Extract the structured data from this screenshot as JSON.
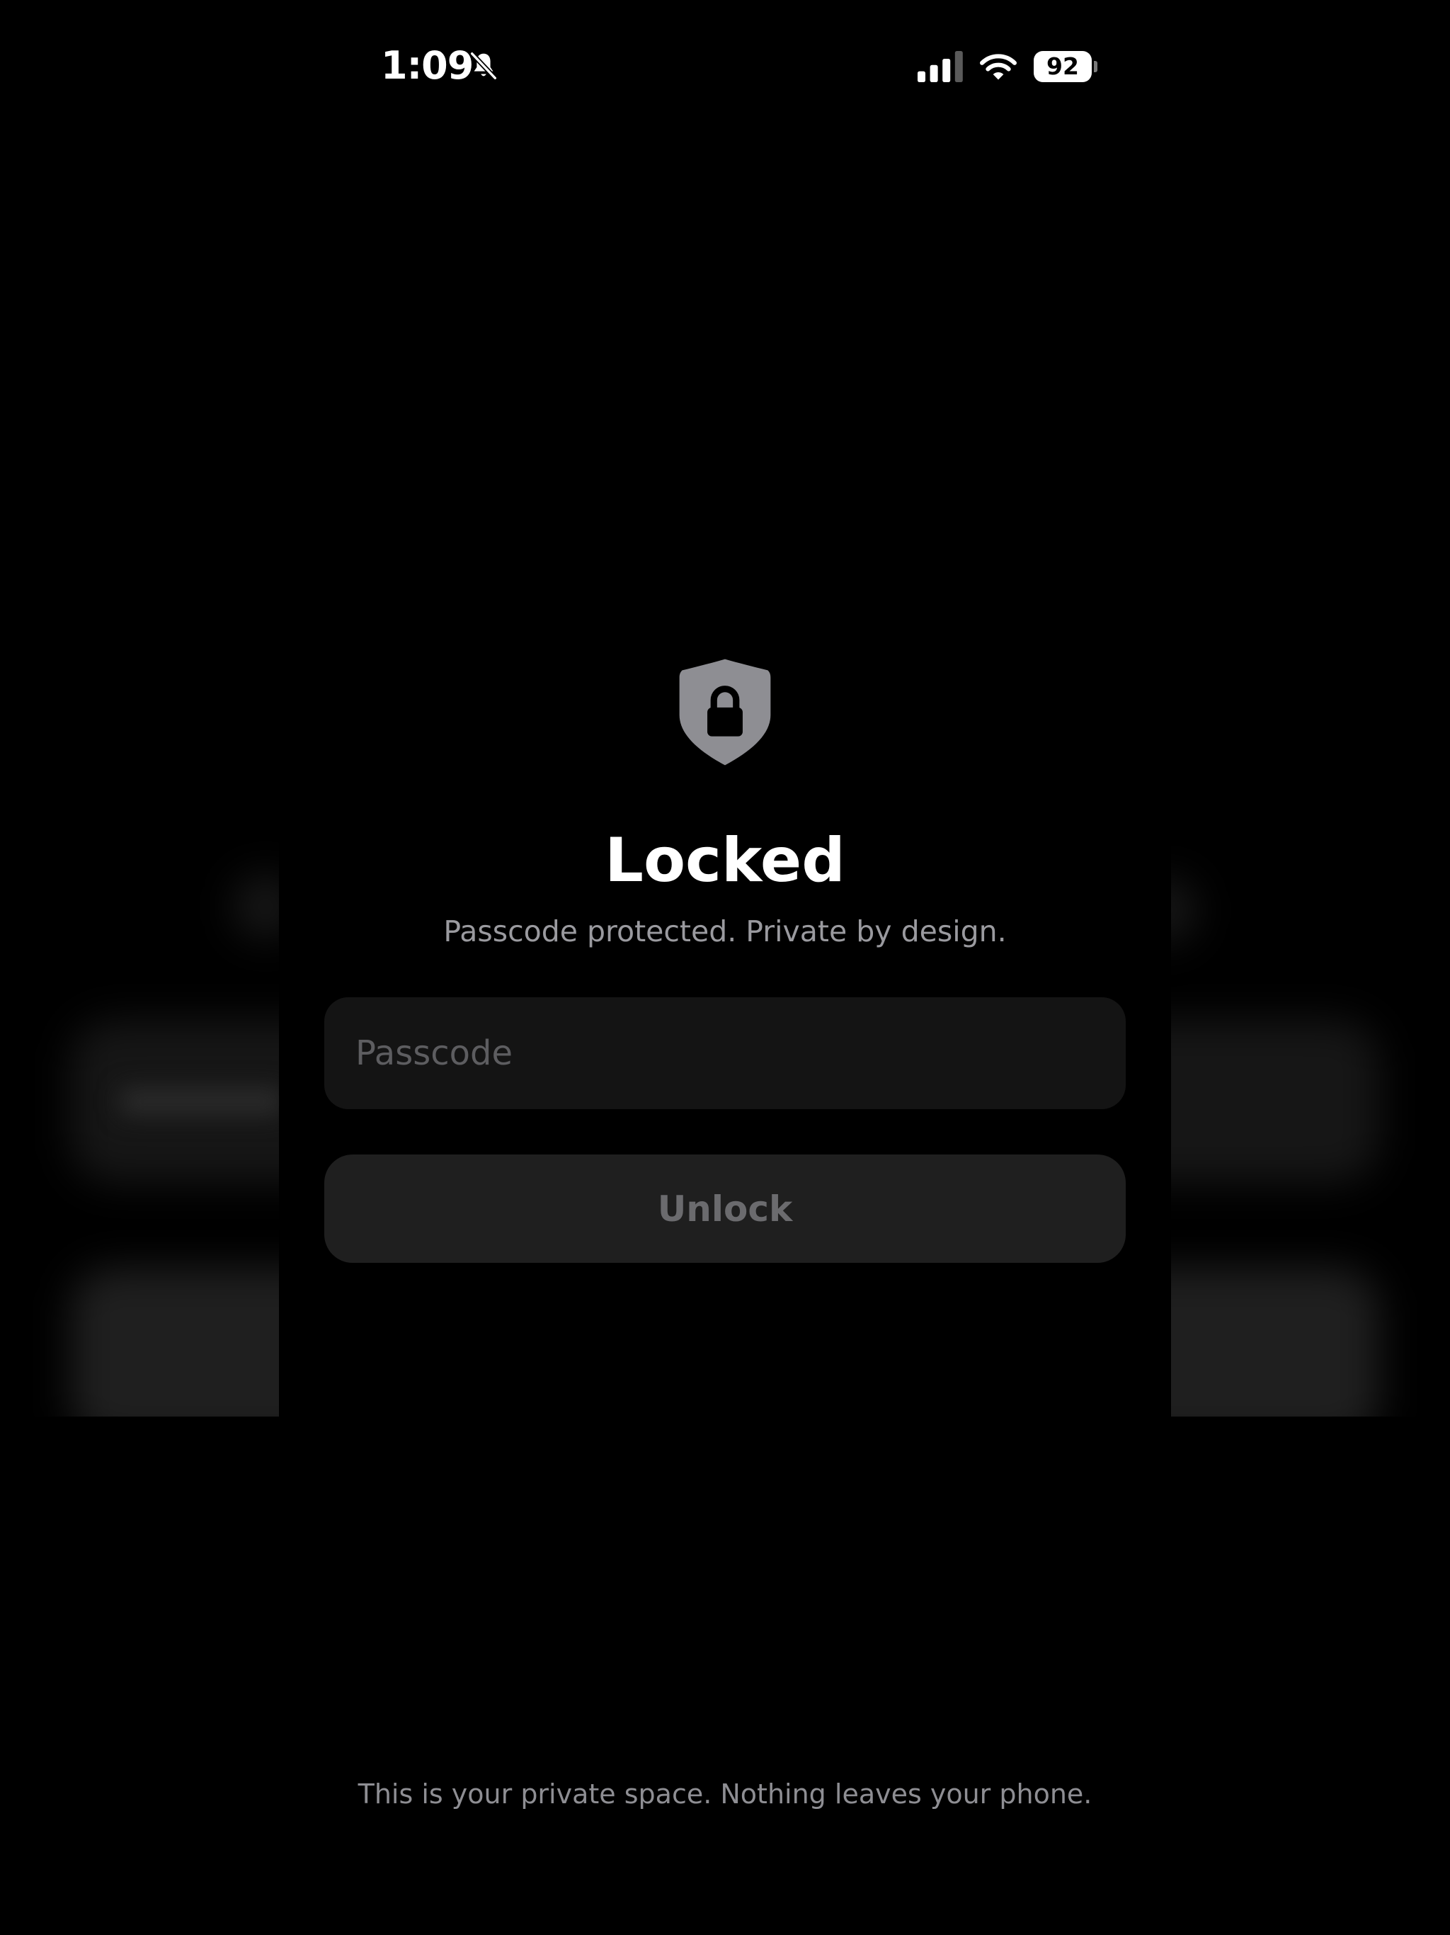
{
  "status_bar": {
    "time": "1:09",
    "battery": "92",
    "icons": [
      "bell-slash-icon",
      "cellular-signal-icon",
      "wifi-icon",
      "battery-icon"
    ]
  },
  "lock": {
    "icon": "shield-lock-icon",
    "title": "Locked",
    "subtitle": "Passcode protected. Private by design.",
    "passcode": {
      "value": "",
      "placeholder": "Passcode"
    },
    "unlock_label": "Unlock",
    "footer": "This is your private space. Nothing leaves your phone."
  },
  "colors": {
    "background": "#000000",
    "input_bg": "#141414",
    "button_bg": "#1f1f1f",
    "shield": "#8e8e93",
    "subtitle": "#9a9a9f"
  }
}
